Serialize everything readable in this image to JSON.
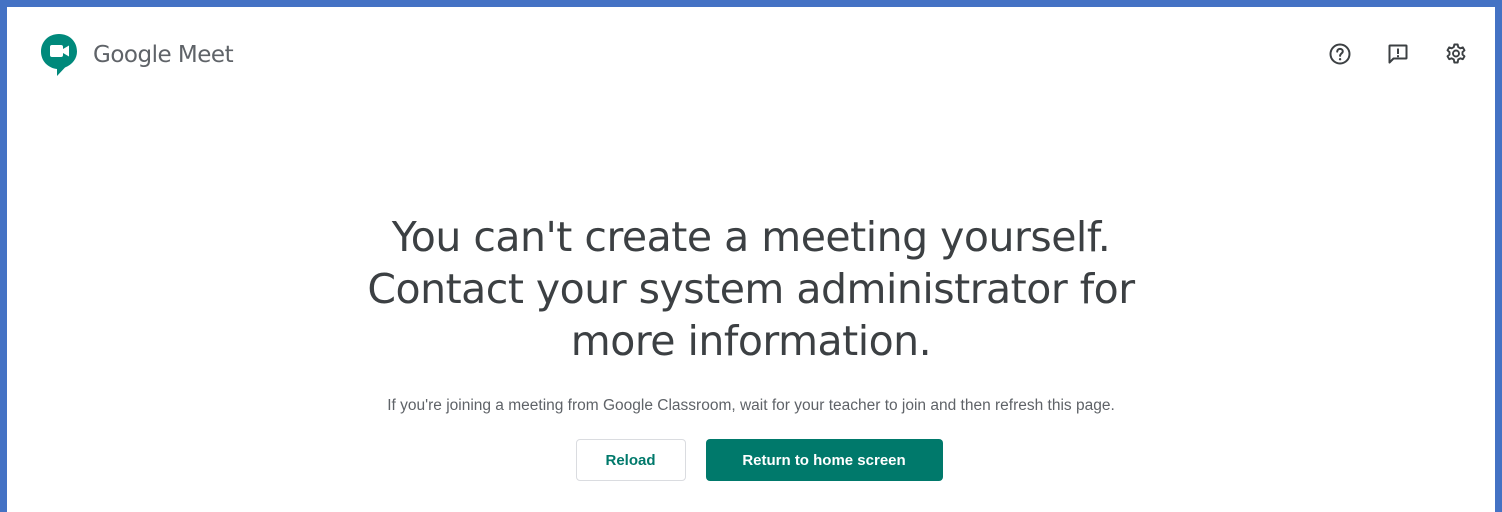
{
  "header": {
    "brand_google": "Google",
    "brand_meet": "Meet",
    "icons": [
      "help-icon",
      "feedback-icon",
      "settings-icon"
    ]
  },
  "main": {
    "headline_line1": "You can't create a meeting yourself.",
    "headline_line2": "Contact your system administrator for",
    "headline_line3": "more information.",
    "subtext": "If you're joining a meeting from Google Classroom, wait for your teacher to join and then refresh this page.",
    "reload_label": "Reload",
    "return_label": "Return to home screen"
  },
  "colors": {
    "frame_border": "#4472c4",
    "accent": "#00796b",
    "text_primary": "#3c4043",
    "text_secondary": "#5f6368"
  }
}
